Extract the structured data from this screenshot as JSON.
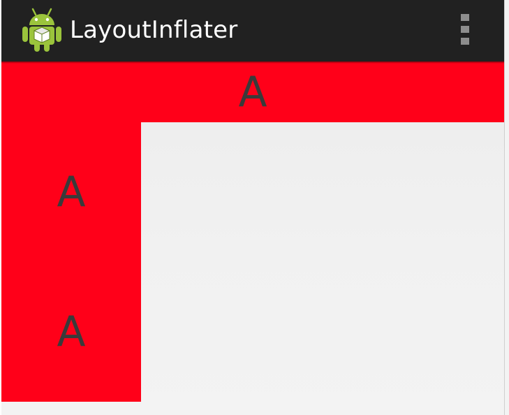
{
  "action_bar": {
    "title": "LayoutInflater",
    "app_icon": "android-robot-icon",
    "overflow_icon": "overflow-menu-icon",
    "background_color": "#212121"
  },
  "content": {
    "items": [
      {
        "label": "A"
      },
      {
        "label": "A"
      },
      {
        "label": "A"
      }
    ],
    "item_color": "#ff0019",
    "text_color": "#3a3a3a"
  }
}
